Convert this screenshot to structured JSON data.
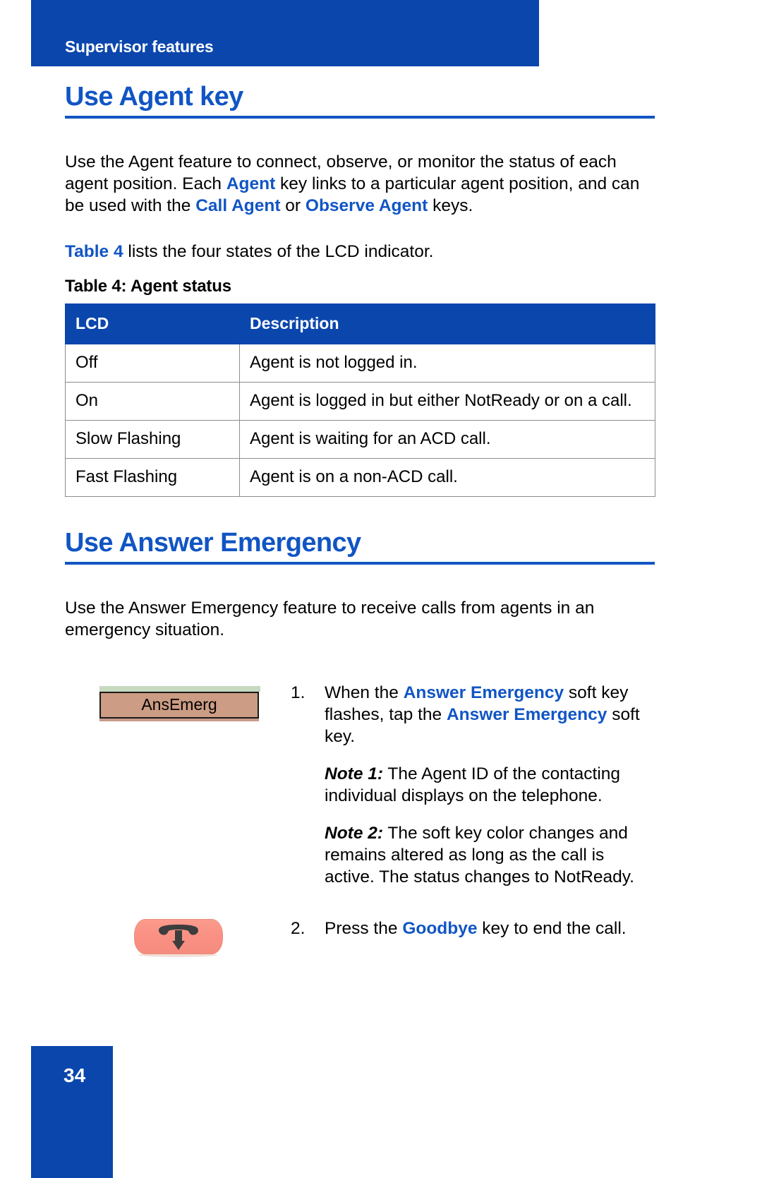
{
  "page": {
    "running_header": "Supervisor features",
    "page_number": "34",
    "colors": {
      "brand_blue": "#0b46ad",
      "heading_blue": "#1155c4",
      "softkey_fill": "#cc9c84",
      "softkey_top_strip": "#c7d9bf",
      "goodbye_key_fill": "#fb9b8d"
    }
  },
  "section1": {
    "heading": "Use Agent key",
    "para1": {
      "part1": "Use the Agent feature to connect, observe, or monitor the status of each agent position. Each ",
      "emph1": "Agent",
      "part2": " key links to a particular agent position, and can be used with the ",
      "emph2": "Call Agent",
      "part3": " or ",
      "emph3": "Observe Agent",
      "part4": " keys."
    },
    "para2": {
      "link": "Table 4",
      "rest": " lists the four states of the LCD indicator."
    },
    "table": {
      "caption": "Table 4: Agent status",
      "headers": [
        "LCD",
        "Description"
      ],
      "rows": [
        [
          "Off",
          "Agent is not logged in."
        ],
        [
          "On",
          "Agent is logged in but either NotReady or on a call."
        ],
        [
          "Slow Flashing",
          "Agent is waiting for an ACD call."
        ],
        [
          "Fast Flashing",
          "Agent is on a non-ACD call."
        ]
      ]
    }
  },
  "section2": {
    "heading": "Use Answer Emergency",
    "intro": "Use the Answer Emergency feature to receive calls from agents in an emergency situation.",
    "steps": [
      {
        "number": "1.",
        "figure_label": "AnsEmerg",
        "text": {
          "part1": "When the ",
          "emph1": "Answer Emergency",
          "part2": " soft key flashes, tap the ",
          "emph2": "Answer Emergency",
          "part3": " soft key."
        },
        "notes": [
          {
            "label": "Note 1:",
            "text": " The Agent ID of the contacting individual displays on the telephone."
          },
          {
            "label": "Note 2:",
            "text": " The soft key color changes and remains altered as long as the call is active. The status changes to NotReady."
          }
        ]
      },
      {
        "number": "2.",
        "figure_label": "goodbye-key",
        "text": {
          "part1": "Press the ",
          "emph1": "Goodbye",
          "part2": " key to end the call."
        }
      }
    ]
  }
}
